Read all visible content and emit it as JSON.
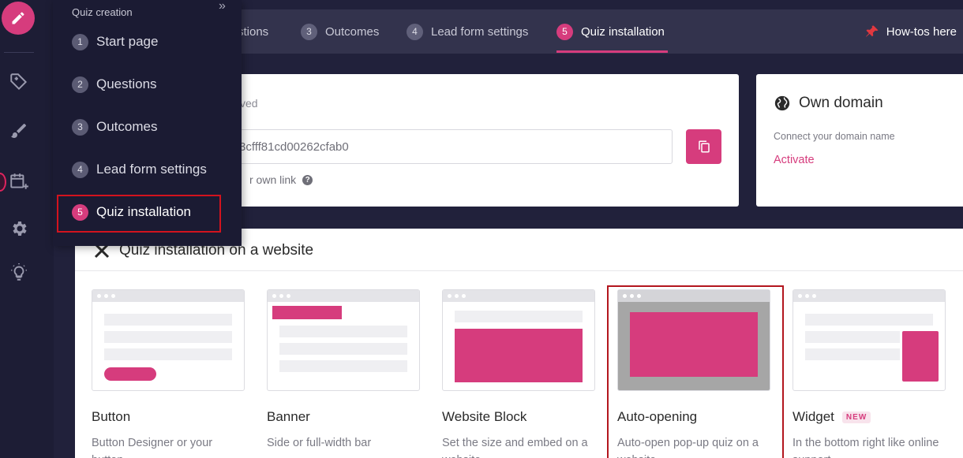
{
  "menu": {
    "heading": "Quiz creation",
    "collapse_icon": "»",
    "items": [
      {
        "num": "1",
        "label": "Start page"
      },
      {
        "num": "2",
        "label": "Questions"
      },
      {
        "num": "3",
        "label": "Outcomes"
      },
      {
        "num": "4",
        "label": "Lead form settings"
      },
      {
        "num": "5",
        "label": "Quiz installation"
      }
    ],
    "active_index": 4
  },
  "topbar": {
    "tabs": [
      {
        "num": "",
        "label": "stions"
      },
      {
        "num": "3",
        "label": "Outcomes"
      },
      {
        "num": "4",
        "label": "Lead form settings"
      },
      {
        "num": "5",
        "label": "Quiz installation"
      }
    ],
    "howtos_label": "How-tos here"
  },
  "link_card": {
    "label_partial": "ved",
    "link_value": "3cfff81cd00262cfab0",
    "own_link_partial": "r own link",
    "help_glyph": "?"
  },
  "domain_card": {
    "title": "Own domain",
    "description": "Connect your domain name",
    "activate_label": "Activate"
  },
  "install": {
    "title": "Quiz installation on a website",
    "options": [
      {
        "title": "Button",
        "desc": "Button Designer or your button",
        "badge": ""
      },
      {
        "title": "Banner",
        "desc": "Side or full-width bar",
        "badge": ""
      },
      {
        "title": "Website Block",
        "desc": "Set the size and embed on a website",
        "badge": ""
      },
      {
        "title": "Auto-opening",
        "desc": "Auto-open pop-up quiz on a website",
        "badge": ""
      },
      {
        "title": "Widget",
        "desc": "In the bottom right like online support",
        "badge": "NEW"
      }
    ]
  },
  "colors": {
    "accent": "#d63c7d",
    "rail": "#1d1d35",
    "topbar": "#33334d",
    "highlight": "#b3161e"
  }
}
